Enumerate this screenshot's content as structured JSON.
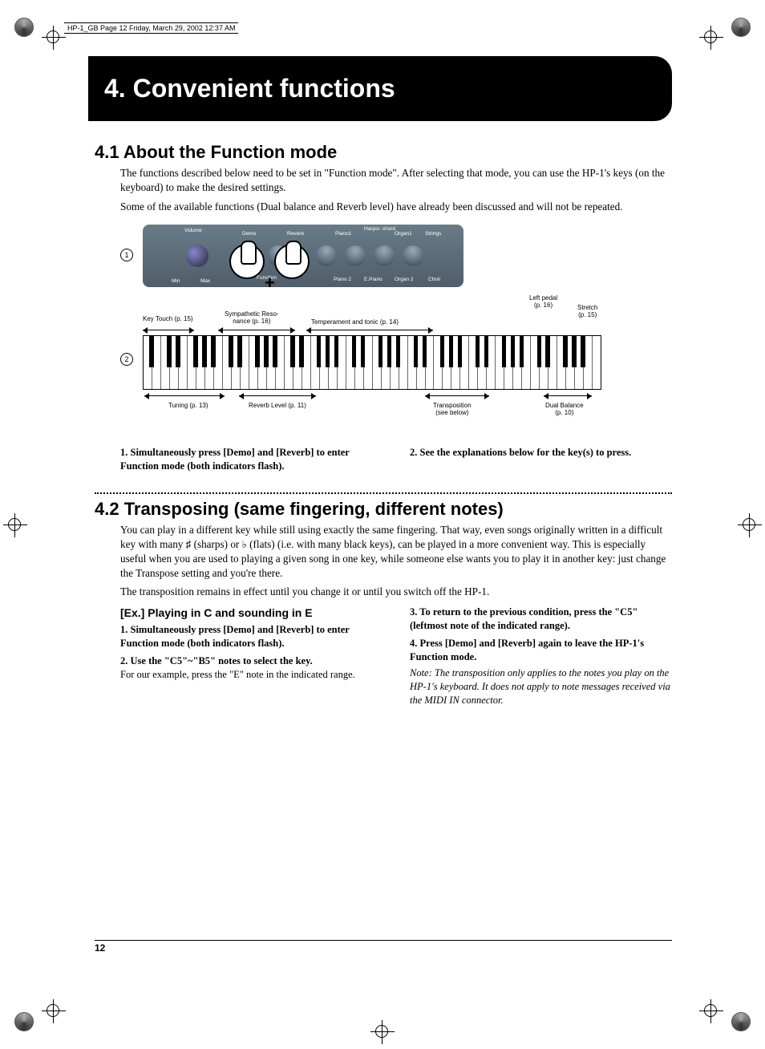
{
  "header_info": "HP-1_GB  Page 12  Friday, March 29, 2002  12:37 AM",
  "chapter_title": "4. Convenient functions",
  "s41": {
    "heading": "4.1 About the Function mode",
    "p1": "The functions described below need to be set in \"Function mode\". After selecting that mode, you can use the HP-1's keys (on the keyboard) to make the desired settings.",
    "p2": "Some of the available functions (Dual balance and Reverb level) have already been discussed and will not be repeated."
  },
  "diagram": {
    "num1": "1",
    "num2": "2",
    "panel": {
      "volume": "Volume",
      "min": "Min",
      "max": "Max",
      "demo": "Demo",
      "reverb": "Reverb",
      "function": "Function",
      "piano1": "Piano1",
      "harpsichord": "Harpsi-\nchord",
      "organ1": "Organ1",
      "strings": "Strings",
      "piano2": "Piano 2",
      "epiano": "E.Piano",
      "organ2": "Organ 2",
      "choir": "Choir"
    },
    "top_labels": {
      "keytouch": "Key Touch (p. 15)",
      "symp": "Sympathetic Reso-\nnance (p. 16)",
      "temp": "Temperament and tonic (p. 14)",
      "leftpedal": "Left pedal\n(p. 16)",
      "stretch": "Stretch\n(p. 15)"
    },
    "bot_labels": {
      "tuning": "Tuning (p. 13)",
      "reverb": "Reverb Level (p. 11)",
      "transp": "Transposition\n(see below)",
      "dual": "Dual Balance\n(p. 10)"
    }
  },
  "s41_steps": {
    "step1": "1. Simultaneously press [Demo] and [Reverb] to enter Function mode (both indicators flash).",
    "step2": "2. See the explanations below for the key(s) to press."
  },
  "s42": {
    "heading": "4.2 Transposing (same fingering, different notes)",
    "p1": "You can play in a different key while still using exactly the same fingering. That way, even songs originally written in a difficult key with many ♯ (sharps) or ♭ (flats) (i.e. with many black keys), can be played in a more convenient way. This is especially useful when you are used to playing a given song in one key, while someone else wants you to play it in another key: just change the Transpose setting and you're there.",
    "p2": "The transposition remains in effect until you change it or until you switch off the HP-1.",
    "ex_head": "[Ex.] Playing in C and sounding in E",
    "ex1": "1. Simultaneously press [Demo] and [Reverb] to enter Function mode (both indicators flash).",
    "ex2a": "2. Use the \"C5\"~\"B5\" notes to select the key.",
    "ex2b": "For our example, press the \"E\" note in the indicated range.",
    "ex3": "3. To return to the previous condition, press the \"C5\" (leftmost note of the indicated range).",
    "ex4": "4. Press [Demo] and [Reverb] again to leave the HP-1's Function mode.",
    "note": "Note: The transposition only applies to the notes you play on the HP-1's keyboard. It does not apply to note messages received via the MIDI IN connector."
  },
  "page_number": "12"
}
